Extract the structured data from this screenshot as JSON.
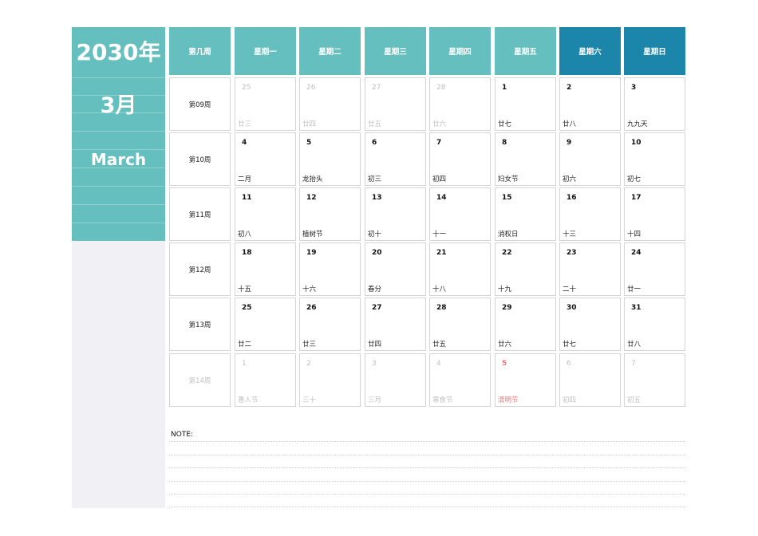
{
  "sidebar": {
    "year": "2030年",
    "month_cn": "3月",
    "month_en": "March"
  },
  "header": {
    "week_label": "第几周",
    "days": [
      "星期一",
      "星期二",
      "星期三",
      "星期四",
      "星期五",
      "星期六",
      "星期日"
    ]
  },
  "colors": {
    "weekday_header": "#65bfbe",
    "weekend_header": "#1b86aa",
    "holiday": "#f07a7a"
  },
  "weeks": [
    {
      "label": "第09周",
      "dim": false,
      "days": [
        {
          "d": "25",
          "l": "廿三",
          "dim": true
        },
        {
          "d": "26",
          "l": "廿四",
          "dim": true
        },
        {
          "d": "27",
          "l": "廿五",
          "dim": true
        },
        {
          "d": "28",
          "l": "廿六",
          "dim": true
        },
        {
          "d": "1",
          "l": "廿七"
        },
        {
          "d": "2",
          "l": "廿八"
        },
        {
          "d": "3",
          "l": "九九天"
        }
      ]
    },
    {
      "label": "第10周",
      "dim": false,
      "days": [
        {
          "d": "4",
          "l": "二月"
        },
        {
          "d": "5",
          "l": "龙抬头"
        },
        {
          "d": "6",
          "l": "初三"
        },
        {
          "d": "7",
          "l": "初四"
        },
        {
          "d": "8",
          "l": "妇女节"
        },
        {
          "d": "9",
          "l": "初六"
        },
        {
          "d": "10",
          "l": "初七"
        }
      ]
    },
    {
      "label": "第11周",
      "dim": false,
      "days": [
        {
          "d": "11",
          "l": "初八"
        },
        {
          "d": "12",
          "l": "植树节"
        },
        {
          "d": "13",
          "l": "初十"
        },
        {
          "d": "14",
          "l": "十一"
        },
        {
          "d": "15",
          "l": "消权日"
        },
        {
          "d": "16",
          "l": "十三"
        },
        {
          "d": "17",
          "l": "十四"
        }
      ]
    },
    {
      "label": "第12周",
      "dim": false,
      "days": [
        {
          "d": "18",
          "l": "十五"
        },
        {
          "d": "19",
          "l": "十六"
        },
        {
          "d": "20",
          "l": "春分"
        },
        {
          "d": "21",
          "l": "十八"
        },
        {
          "d": "22",
          "l": "十九"
        },
        {
          "d": "23",
          "l": "二十"
        },
        {
          "d": "24",
          "l": "廿一"
        }
      ]
    },
    {
      "label": "第13周",
      "dim": false,
      "days": [
        {
          "d": "25",
          "l": "廿二"
        },
        {
          "d": "26",
          "l": "廿三"
        },
        {
          "d": "27",
          "l": "廿四"
        },
        {
          "d": "28",
          "l": "廿五"
        },
        {
          "d": "29",
          "l": "廿六"
        },
        {
          "d": "30",
          "l": "廿七"
        },
        {
          "d": "31",
          "l": "廿八"
        }
      ]
    },
    {
      "label": "第14周",
      "dim": true,
      "days": [
        {
          "d": "1",
          "l": "愚人节",
          "dim": true
        },
        {
          "d": "2",
          "l": "三十",
          "dim": true
        },
        {
          "d": "3",
          "l": "三月",
          "dim": true
        },
        {
          "d": "4",
          "l": "寒食节",
          "dim": true
        },
        {
          "d": "5",
          "l": "清明节",
          "hol": true
        },
        {
          "d": "6",
          "l": "初四",
          "dim": true
        },
        {
          "d": "7",
          "l": "初五",
          "dim": true
        }
      ]
    }
  ],
  "note": {
    "label": "NOTE:"
  }
}
